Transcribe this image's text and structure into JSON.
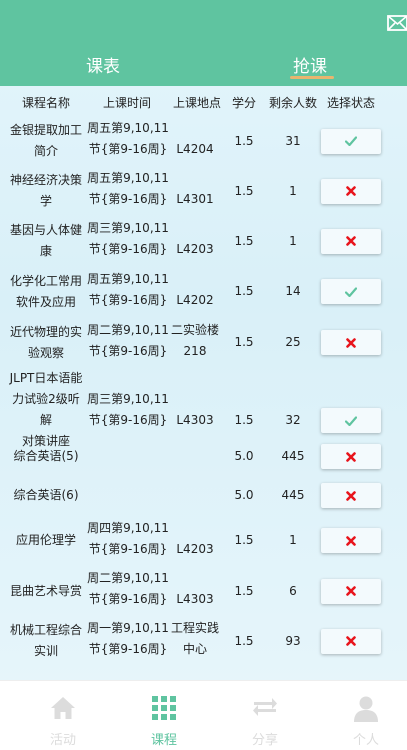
{
  "header": {
    "tabs": [
      {
        "label": "课表"
      },
      {
        "label": "抢课"
      }
    ],
    "accent": "#5fc4a0"
  },
  "columns": [
    "课程名称",
    "上课时间",
    "上课地点",
    "学分",
    "剩余人数",
    "选择状态"
  ],
  "courses": [
    {
      "name": [
        "金银提取加工",
        "简介"
      ],
      "time": [
        "周五第9,10,11",
        "节{第9-16周}"
      ],
      "place": [
        "L4204"
      ],
      "credit": "1.5",
      "remaining": "31",
      "status": "selected"
    },
    {
      "name": [
        "神经经济决策",
        "学"
      ],
      "time": [
        "周五第9,10,11",
        "节{第9-16周}"
      ],
      "place": [
        "L4301"
      ],
      "credit": "1.5",
      "remaining": "1",
      "status": "unavailable"
    },
    {
      "name": [
        "基因与人体健",
        "康"
      ],
      "time": [
        "周三第9,10,11",
        "节{第9-16周}"
      ],
      "place": [
        "L4203"
      ],
      "credit": "1.5",
      "remaining": "1",
      "status": "unavailable"
    },
    {
      "name": [
        "化学化工常用",
        "软件及应用"
      ],
      "time": [
        "周五第9,10,11",
        "节{第9-16周}"
      ],
      "place": [
        "L4202"
      ],
      "credit": "1.5",
      "remaining": "14",
      "status": "selected"
    },
    {
      "name": [
        "近代物理的实",
        "验观察"
      ],
      "time": [
        "周二第9,10,11",
        "节{第9-16周}"
      ],
      "place": [
        "二实验楼",
        "218"
      ],
      "credit": "1.5",
      "remaining": "25",
      "status": "unavailable"
    },
    {
      "name": [
        "JLPT日本语能",
        "力试验2级听解",
        "对策讲座"
      ],
      "time": [
        "周三第9,10,11",
        "节{第9-16周}"
      ],
      "place": [
        "L4303"
      ],
      "credit": "1.5",
      "remaining": "32",
      "status": "selected"
    },
    {
      "name": [
        "综合英语(5)"
      ],
      "time": [],
      "place": [],
      "credit": "5.0",
      "remaining": "445",
      "status": "unavailable"
    },
    {
      "name": [
        "综合英语(6)"
      ],
      "time": [],
      "place": [],
      "credit": "5.0",
      "remaining": "445",
      "status": "unavailable"
    },
    {
      "name": [
        "应用伦理学"
      ],
      "time": [
        "周四第9,10,11",
        "节{第9-16周}"
      ],
      "place": [
        "L4203"
      ],
      "credit": "1.5",
      "remaining": "1",
      "status": "unavailable"
    },
    {
      "name": [
        "昆曲艺术导赏"
      ],
      "time": [
        "周二第9,10,11",
        "节{第9-16周}"
      ],
      "place": [
        "L4303"
      ],
      "credit": "1.5",
      "remaining": "6",
      "status": "unavailable"
    },
    {
      "name": [
        "机械工程综合",
        "实训"
      ],
      "time": [
        "周一第9,10,11",
        "节{第9-16周}"
      ],
      "place": [
        "工程实践",
        "中心"
      ],
      "credit": "1.5",
      "remaining": "93",
      "status": "unavailable"
    }
  ],
  "status_icons": {
    "selected": "check-icon",
    "unavailable": "cross-icon"
  },
  "status_colors": {
    "selected": "#5fc4a0",
    "unavailable": "#e8141c"
  },
  "nav": [
    {
      "label": "活动",
      "icon": "home-icon",
      "active": false
    },
    {
      "label": "课程",
      "icon": "grid-icon",
      "active": true
    },
    {
      "label": "分享",
      "icon": "share-icon",
      "active": false
    },
    {
      "label": "个人",
      "icon": "person-icon",
      "active": false
    }
  ]
}
